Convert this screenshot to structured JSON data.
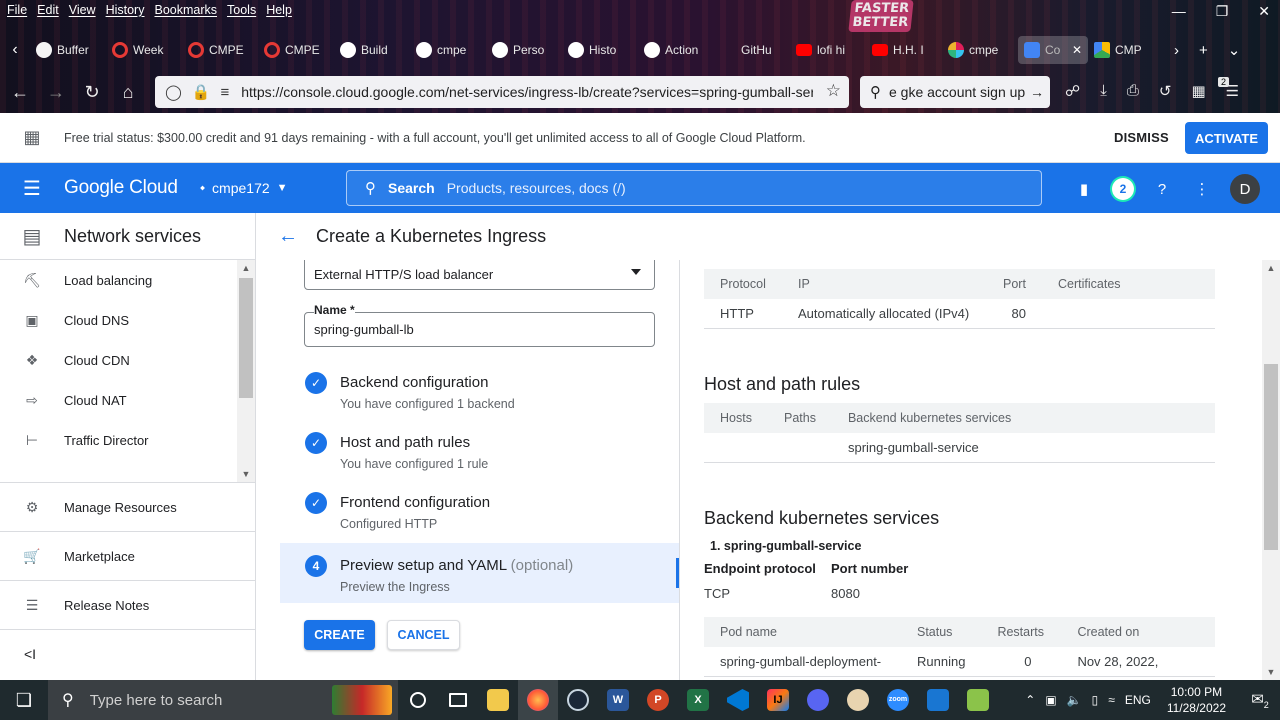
{
  "browser": {
    "menu": [
      "File",
      "Edit",
      "View",
      "History",
      "Bookmarks",
      "Tools",
      "Help"
    ],
    "neon_sign": "FASTER BETTER",
    "tabs": [
      {
        "label": "Buffer",
        "color": "#f5f5f5"
      },
      {
        "label": "Week",
        "color": "#e53935"
      },
      {
        "label": "CMPE",
        "color": "#e53935"
      },
      {
        "label": "CMPE",
        "color": "#e53935"
      },
      {
        "label": "Build",
        "color": "#ffffff"
      },
      {
        "label": "cmpe",
        "color": "#ffffff"
      },
      {
        "label": "Perso",
        "color": "#ffffff"
      },
      {
        "label": "Histo",
        "color": "#ffffff"
      },
      {
        "label": "Action",
        "color": "#ffffff"
      },
      {
        "label": "GitHu",
        "color": "#9e9e9e"
      },
      {
        "label": "lofi hi",
        "color": "#ff0000"
      },
      {
        "label": "H.H. I",
        "color": "#ff0000"
      },
      {
        "label": "cmpe",
        "color": "#e91e63"
      },
      {
        "label": "Co",
        "color": "#4285f4"
      },
      {
        "label": "CMP",
        "color": "#34a853"
      }
    ],
    "url": "https://console.cloud.google.com/net-services/ingress-lb/create?services=spring-gumball-serv",
    "search": "e gke account sign up",
    "toolbar_badge": "2"
  },
  "trial": {
    "message": "Free trial status: $300.00 credit and 91 days remaining - with a full account, you'll get unlimited access to all of Google Cloud Platform.",
    "dismiss": "DISMISS",
    "activate": "ACTIVATE"
  },
  "header": {
    "logo": "Google Cloud",
    "project": "cmpe172",
    "search_label": "Search",
    "search_placeholder": "Products, resources, docs (/)",
    "notifications": "2",
    "avatar": "D"
  },
  "sidebar": {
    "title": "Network services",
    "items": [
      {
        "label": "Load balancing",
        "icon": "load-balancing-icon"
      },
      {
        "label": "Cloud DNS",
        "icon": "dns-icon"
      },
      {
        "label": "Cloud CDN",
        "icon": "cdn-icon"
      },
      {
        "label": "Cloud NAT",
        "icon": "nat-icon"
      },
      {
        "label": "Traffic Director",
        "icon": "traffic-director-icon"
      }
    ],
    "bottom": [
      {
        "label": "Manage Resources",
        "icon": "manage-resources-icon"
      },
      {
        "label": "Marketplace",
        "icon": "marketplace-icon"
      },
      {
        "label": "Release Notes",
        "icon": "release-notes-icon"
      }
    ],
    "collapse": "<I"
  },
  "page": {
    "title": "Create a Kubernetes Ingress",
    "lb_type": "External HTTP/S load balancer",
    "name_label": "Name *",
    "name_value": "spring-gumball-lb",
    "steps": [
      {
        "title": "Backend configuration",
        "sub": "You have configured 1 backend",
        "marker": "✓"
      },
      {
        "title": "Host and path rules",
        "sub": "You have configured 1 rule",
        "marker": "✓"
      },
      {
        "title": "Frontend configuration",
        "sub": "Configured HTTP",
        "marker": "✓"
      },
      {
        "title": "Preview setup and YAML",
        "optional": "(optional)",
        "sub": "Preview the Ingress",
        "marker": "4"
      }
    ],
    "create": "CREATE",
    "cancel": "CANCEL"
  },
  "preview": {
    "frontend_headers": [
      "Protocol",
      "IP",
      "Port",
      "Certificates"
    ],
    "frontend_row": [
      "HTTP",
      "Automatically allocated (IPv4)",
      "80",
      ""
    ],
    "host_title": "Host and path rules",
    "host_headers": [
      "Hosts",
      "Paths",
      "Backend kubernetes services"
    ],
    "host_row": [
      "",
      "",
      "spring-gumball-service"
    ],
    "backend_title": "Backend kubernetes services",
    "backend_item": "1.   spring-gumball-service",
    "endpoint_label": "Endpoint protocol",
    "port_label": "Port number",
    "endpoint_value": "TCP",
    "port_value": "8080",
    "pod_headers": [
      "Pod name",
      "Status",
      "Restarts",
      "Created on"
    ],
    "pod_row": [
      "spring-gumball-deployment-",
      "Running",
      "0",
      "Nov 28, 2022,"
    ]
  },
  "taskbar": {
    "search_placeholder": "Type here to search",
    "language": "ENG",
    "time": "10:00 PM",
    "date": "11/28/2022",
    "notifications": "2"
  }
}
